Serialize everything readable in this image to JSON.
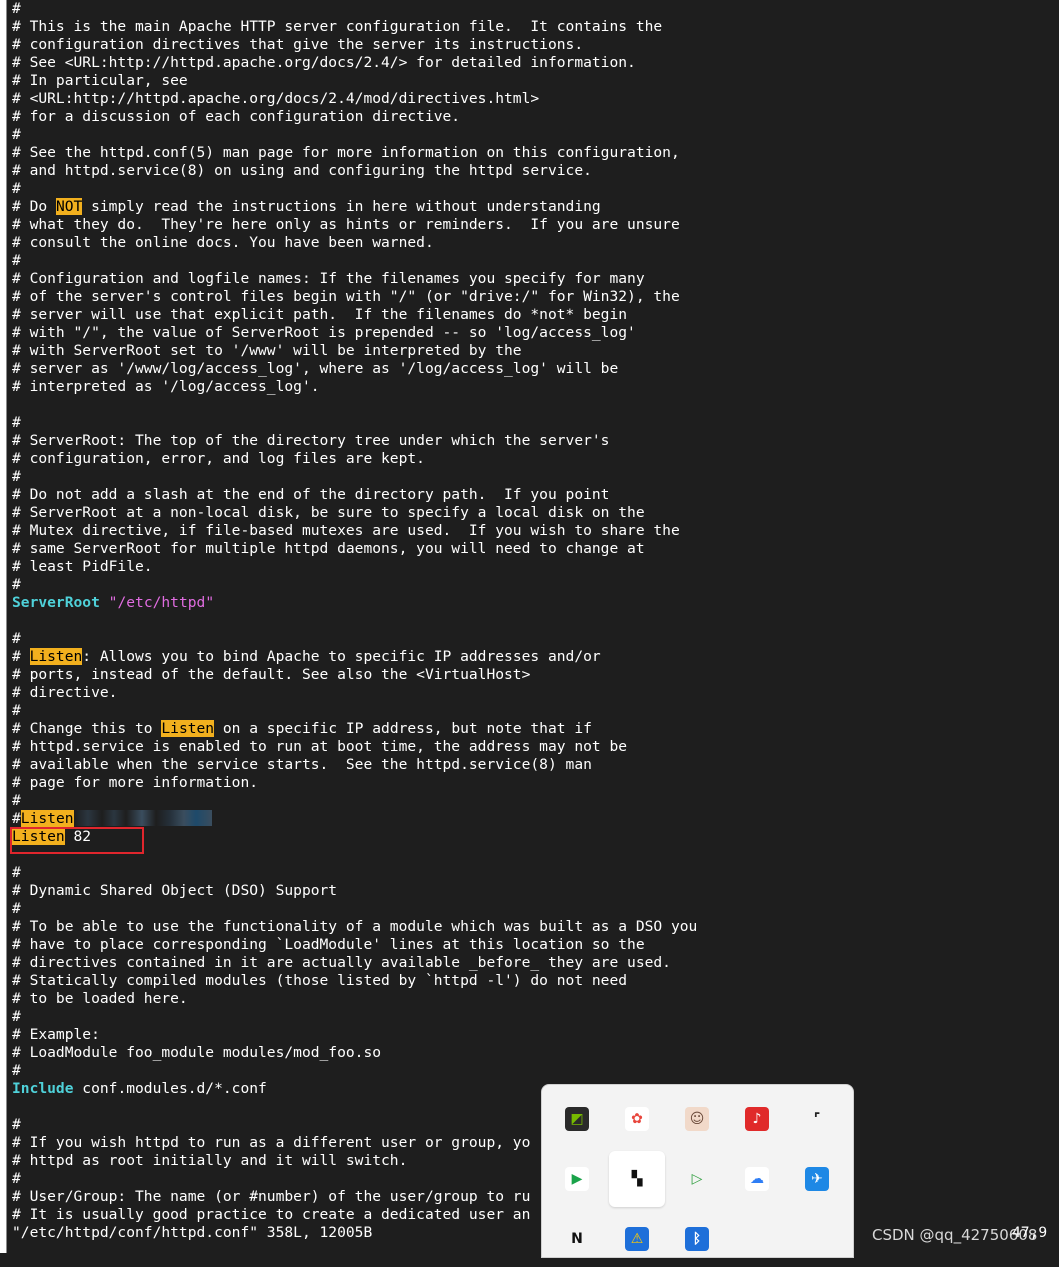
{
  "editor": {
    "lines": [
      [
        {
          "t": "comment",
          "v": "#"
        }
      ],
      [
        {
          "t": "comment",
          "v": "# This is the main Apache HTTP server configuration file.  It contains the"
        }
      ],
      [
        {
          "t": "comment",
          "v": "# configuration directives that give the server its instructions."
        }
      ],
      [
        {
          "t": "comment",
          "v": "# See <URL:http://httpd.apache.org/docs/2.4/> for detailed information."
        }
      ],
      [
        {
          "t": "comment",
          "v": "# In particular, see"
        }
      ],
      [
        {
          "t": "comment",
          "v": "# <URL:http://httpd.apache.org/docs/2.4/mod/directives.html>"
        }
      ],
      [
        {
          "t": "comment",
          "v": "# for a discussion of each configuration directive."
        }
      ],
      [
        {
          "t": "comment",
          "v": "#"
        }
      ],
      [
        {
          "t": "comment",
          "v": "# See the httpd.conf(5) man page for more information on this configuration,"
        }
      ],
      [
        {
          "t": "comment",
          "v": "# and httpd.service(8) on using and configuring the httpd service."
        }
      ],
      [
        {
          "t": "comment",
          "v": "#"
        }
      ],
      [
        {
          "t": "comment",
          "v": "# Do "
        },
        {
          "t": "hl",
          "v": "NOT"
        },
        {
          "t": "comment",
          "v": " simply read the instructions in here without understanding"
        }
      ],
      [
        {
          "t": "comment",
          "v": "# what they do.  They're here only as hints or reminders.  If you are unsure"
        }
      ],
      [
        {
          "t": "comment",
          "v": "# consult the online docs. You have been warned."
        }
      ],
      [
        {
          "t": "comment",
          "v": "#"
        }
      ],
      [
        {
          "t": "comment",
          "v": "# Configuration and logfile names: If the filenames you specify for many"
        }
      ],
      [
        {
          "t": "comment",
          "v": "# of the server's control files begin with \"/\" (or \"drive:/\" for Win32), the"
        }
      ],
      [
        {
          "t": "comment",
          "v": "# server will use that explicit path.  If the filenames do *not* begin"
        }
      ],
      [
        {
          "t": "comment",
          "v": "# with \"/\", the value of ServerRoot is prepended -- so 'log/access_log'"
        }
      ],
      [
        {
          "t": "comment",
          "v": "# with ServerRoot set to '/www' will be interpreted by the"
        }
      ],
      [
        {
          "t": "comment",
          "v": "# server as '/www/log/access_log', where as '/log/access_log' will be"
        }
      ],
      [
        {
          "t": "comment",
          "v": "# interpreted as '/log/access_log'."
        }
      ],
      [],
      [
        {
          "t": "comment",
          "v": "#"
        }
      ],
      [
        {
          "t": "comment",
          "v": "# ServerRoot: The top of the directory tree under which the server's"
        }
      ],
      [
        {
          "t": "comment",
          "v": "# configuration, error, and log files are kept."
        }
      ],
      [
        {
          "t": "comment",
          "v": "#"
        }
      ],
      [
        {
          "t": "comment",
          "v": "# Do not add a slash at the end of the directory path.  If you point"
        }
      ],
      [
        {
          "t": "comment",
          "v": "# ServerRoot at a non-local disk, be sure to specify a local disk on the"
        }
      ],
      [
        {
          "t": "comment",
          "v": "# Mutex directive, if file-based mutexes are used.  If you wish to share the"
        }
      ],
      [
        {
          "t": "comment",
          "v": "# same ServerRoot for multiple httpd daemons, you will need to change at"
        }
      ],
      [
        {
          "t": "comment",
          "v": "# least PidFile."
        }
      ],
      [
        {
          "t": "comment",
          "v": "#"
        }
      ],
      [
        {
          "t": "kw",
          "v": "ServerRoot"
        },
        {
          "t": "plain",
          "v": " "
        },
        {
          "t": "str",
          "v": "\"/etc/httpd\""
        }
      ],
      [],
      [
        {
          "t": "comment",
          "v": "#"
        }
      ],
      [
        {
          "t": "comment",
          "v": "# "
        },
        {
          "t": "hl",
          "v": "Listen"
        },
        {
          "t": "comment",
          "v": ": Allows you to bind Apache to specific IP addresses and/or"
        }
      ],
      [
        {
          "t": "comment",
          "v": "# ports, instead of the default. See also the <VirtualHost>"
        }
      ],
      [
        {
          "t": "comment",
          "v": "# directive."
        }
      ],
      [
        {
          "t": "comment",
          "v": "#"
        }
      ],
      [
        {
          "t": "comment",
          "v": "# Change this to "
        },
        {
          "t": "hl",
          "v": "Listen"
        },
        {
          "t": "comment",
          "v": " on a specific IP address, but note that if"
        }
      ],
      [
        {
          "t": "comment",
          "v": "# httpd.service is enabled to run at boot time, the address may not be"
        }
      ],
      [
        {
          "t": "comment",
          "v": "# available when the service starts.  See the httpd.service(8) man"
        }
      ],
      [
        {
          "t": "comment",
          "v": "# page for more information."
        }
      ],
      [
        {
          "t": "comment",
          "v": "#"
        }
      ],
      [
        {
          "t": "comment",
          "v": "#"
        },
        {
          "t": "hl",
          "v": "Listen"
        },
        {
          "t": "blur",
          "v": ""
        }
      ],
      [
        {
          "t": "hl",
          "v": "Listen"
        },
        {
          "t": "plain",
          "v": " 82"
        }
      ],
      [],
      [
        {
          "t": "comment",
          "v": "#"
        }
      ],
      [
        {
          "t": "comment",
          "v": "# Dynamic Shared Object (DSO) Support"
        }
      ],
      [
        {
          "t": "comment",
          "v": "#"
        }
      ],
      [
        {
          "t": "comment",
          "v": "# To be able to use the functionality of a module which was built as a DSO you"
        }
      ],
      [
        {
          "t": "comment",
          "v": "# have to place corresponding `LoadModule' lines at this location so the"
        }
      ],
      [
        {
          "t": "comment",
          "v": "# directives contained in it are actually available _before_ they are used."
        }
      ],
      [
        {
          "t": "comment",
          "v": "# Statically compiled modules (those listed by `httpd -l') do not need"
        }
      ],
      [
        {
          "t": "comment",
          "v": "# to be loaded here."
        }
      ],
      [
        {
          "t": "comment",
          "v": "#"
        }
      ],
      [
        {
          "t": "comment",
          "v": "# Example:"
        }
      ],
      [
        {
          "t": "comment",
          "v": "# LoadModule foo_module modules/mod_foo.so"
        }
      ],
      [
        {
          "t": "comment",
          "v": "#"
        }
      ],
      [
        {
          "t": "kw",
          "v": "Include"
        },
        {
          "t": "plain",
          "v": " conf.modules.d/*.conf"
        }
      ],
      [],
      [
        {
          "t": "comment",
          "v": "#"
        }
      ],
      [
        {
          "t": "comment",
          "v": "# If you wish httpd to run as a different user or group, yo"
        }
      ],
      [
        {
          "t": "comment",
          "v": "# httpd as root initially and it will switch."
        }
      ],
      [
        {
          "t": "comment",
          "v": "#"
        }
      ],
      [
        {
          "t": "comment",
          "v": "# User/Group: The name (or #number) of the user/group to ru"
        }
      ],
      [
        {
          "t": "comment",
          "v": "# It is usually good practice to create a dedicated user an"
        }
      ]
    ]
  },
  "status": {
    "file_info": "\"/etc/httpd/conf/httpd.conf\" 358L, 12005B",
    "cursor_pos": "47,9"
  },
  "watermark": "CSDN @qq_42750608",
  "tray": {
    "icons": [
      {
        "name": "nvidia-icon",
        "color": "#2a2a2a",
        "fg": "#76b900",
        "glyph": "◩"
      },
      {
        "name": "colorful-app-icon",
        "color": "#ffffff",
        "fg": "#e8453c",
        "glyph": "✿"
      },
      {
        "name": "anime-avatar-icon",
        "color": "#f1d9c9",
        "fg": "#6a4a3a",
        "glyph": "☺"
      },
      {
        "name": "red-app-icon",
        "color": "#e02a2a",
        "fg": "#ffffff",
        "glyph": "♪"
      },
      {
        "name": "screenshot-tool-icon",
        "color": "#f3f3f3",
        "fg": "#222222",
        "glyph": "⌜"
      },
      {
        "name": "media-player-icon",
        "color": "#ffffff",
        "fg": "#1aa34a",
        "glyph": "▶"
      },
      {
        "name": "dark-grid-icon",
        "color": "#ffffff",
        "fg": "#111111",
        "glyph": "▚"
      },
      {
        "name": "screen-recorder-icon",
        "color": "#f3f3f3",
        "fg": "#2e9e3e",
        "glyph": "▷"
      },
      {
        "name": "cloud-drive-icon",
        "color": "#ffffff",
        "fg": "#2f7ef5",
        "glyph": "☁"
      },
      {
        "name": "messenger-icon",
        "color": "#1e88e5",
        "fg": "#ffffff",
        "glyph": "✈"
      },
      {
        "name": "notion-like-icon",
        "color": "#f3f3f3",
        "fg": "#111111",
        "glyph": "N"
      },
      {
        "name": "security-shield-warning-icon",
        "color": "#1e6fd9",
        "fg": "#ffcc00",
        "glyph": "⚠"
      },
      {
        "name": "bluetooth-icon",
        "color": "#1e6fd9",
        "fg": "#ffffff",
        "glyph": "ᛒ"
      }
    ],
    "selected_index": 6
  }
}
